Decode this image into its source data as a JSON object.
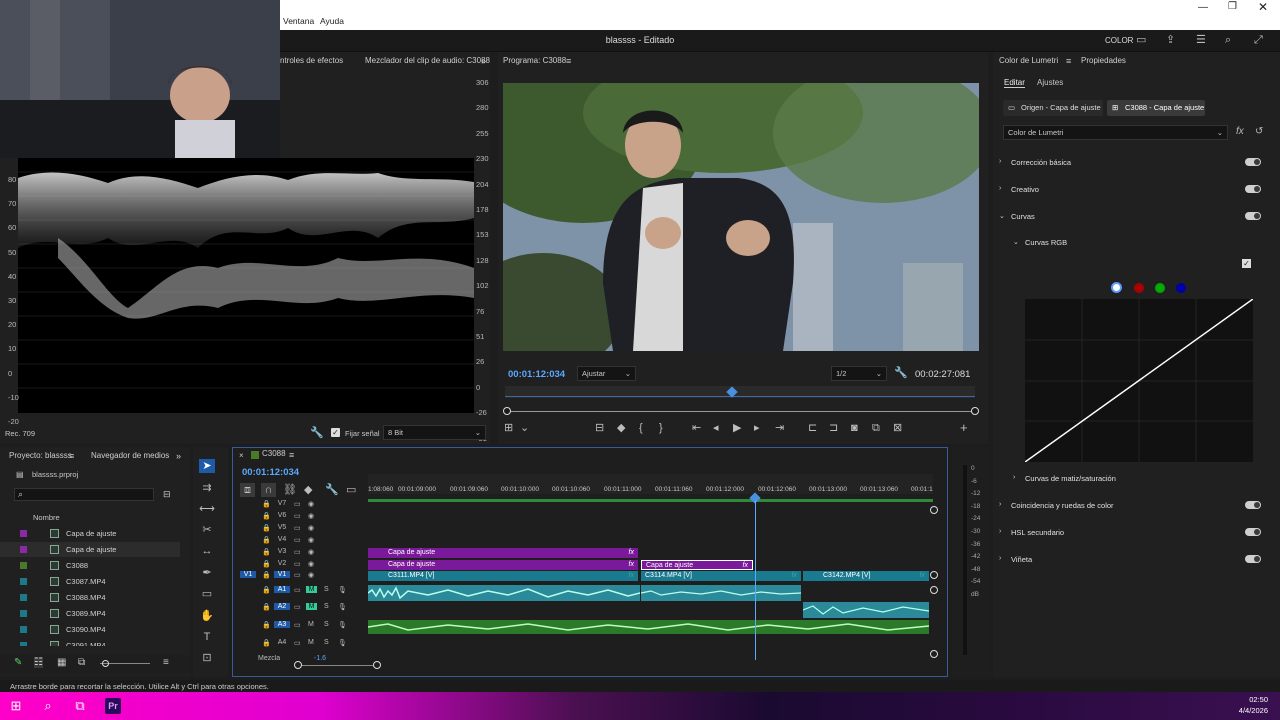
{
  "menu": {
    "items": [
      "Ventana",
      "Ayuda"
    ]
  },
  "window": {
    "title": "blassss - Editado",
    "workspace": "COLOR"
  },
  "scope": {
    "tabs": [
      "ntroles de efectos",
      "Mezclador del clip de audio: C3088"
    ],
    "left_scale": [
      "80",
      "70",
      "60",
      "50",
      "40",
      "30",
      "20",
      "10",
      "0",
      "-10",
      "-20"
    ],
    "right_scale": [
      "306",
      "280",
      "255",
      "230",
      "204",
      "178",
      "153",
      "128",
      "102",
      "76",
      "51",
      "26",
      "0",
      "-26",
      "-51"
    ],
    "rec": "Rec. 709",
    "fijar": "Fijar señal",
    "bit": "8 Bit"
  },
  "program": {
    "tab": "Programa: C3088",
    "timecode": "00:01:12:034",
    "fit": "Ajustar",
    "res": "1/2",
    "duration": "00:02:27:081"
  },
  "lumetri": {
    "tabs": [
      "Color de Lumetri",
      "Propiedades"
    ],
    "subtabs": [
      "Editar",
      "Ajustes"
    ],
    "origin": "Origen - Capa de ajuste",
    "target": "C3088 - Capa de ajuste",
    "effect": "Color de Lumetri",
    "sections": [
      "Corrección básica",
      "Creativo",
      "Curvas",
      "Curvas RGB",
      "Curvas de matiz/saturación",
      "Coincidencia y ruedas de color",
      "HSL secundario",
      "Viñeta"
    ]
  },
  "project": {
    "tabs": [
      "Proyecto: blassss",
      "Navegador de medios"
    ],
    "file": "blassss.prproj",
    "col": "Nombre",
    "items": [
      {
        "name": "Capa de ajuste",
        "color": "#8a2aa8"
      },
      {
        "name": "Capa de ajuste",
        "color": "#8a2aa8"
      },
      {
        "name": "C3088",
        "color": "#4a7a28"
      },
      {
        "name": "C3087.MP4",
        "color": "#1a7a8a"
      },
      {
        "name": "C3088.MP4",
        "color": "#1a7a8a"
      },
      {
        "name": "C3089.MP4",
        "color": "#1a7a8a"
      },
      {
        "name": "C3090.MP4",
        "color": "#1a7a8a"
      },
      {
        "name": "C3091.MP4",
        "color": "#1a7a8a"
      }
    ]
  },
  "timeline": {
    "seq": "C3088",
    "timecode": "00:01:12:034",
    "ruler": [
      "1:08:060",
      "00:01:09:000",
      "00:01:09:060",
      "00:01:10:000",
      "00:01:10:060",
      "00:01:11:000",
      "00:01:11:060",
      "00:01:12:000",
      "00:01:12:060",
      "00:01:13:000",
      "00:01:13:060",
      "00:01:1"
    ],
    "vtracks": [
      "V7",
      "V6",
      "V5",
      "V4",
      "V3",
      "V2",
      "V1"
    ],
    "atracks": [
      "A1",
      "A2",
      "A3",
      "A4"
    ],
    "clips": {
      "c1": "Capa de ajuste",
      "c2": "Capa de ajuste",
      "c3": "Capa de ajuste",
      "v1": "C3111.MP4 [V]",
      "v2": "C3114.MP4 [V]",
      "v3": "C3142.MP4 [V]"
    },
    "mezcla": "Mezcla",
    "mezcla_val": "-1.6"
  },
  "meter": {
    "scale": [
      "0",
      "-6",
      "-12",
      "-18",
      "-24",
      "-30",
      "-36",
      "-42",
      "-48",
      "-54",
      "dB"
    ]
  },
  "status": "Arrastre borde para recortar la selección. Utilice Alt y Ctrl para otras opciones.",
  "taskbar": {
    "time": "02:50",
    "date": "4/4/2026"
  }
}
